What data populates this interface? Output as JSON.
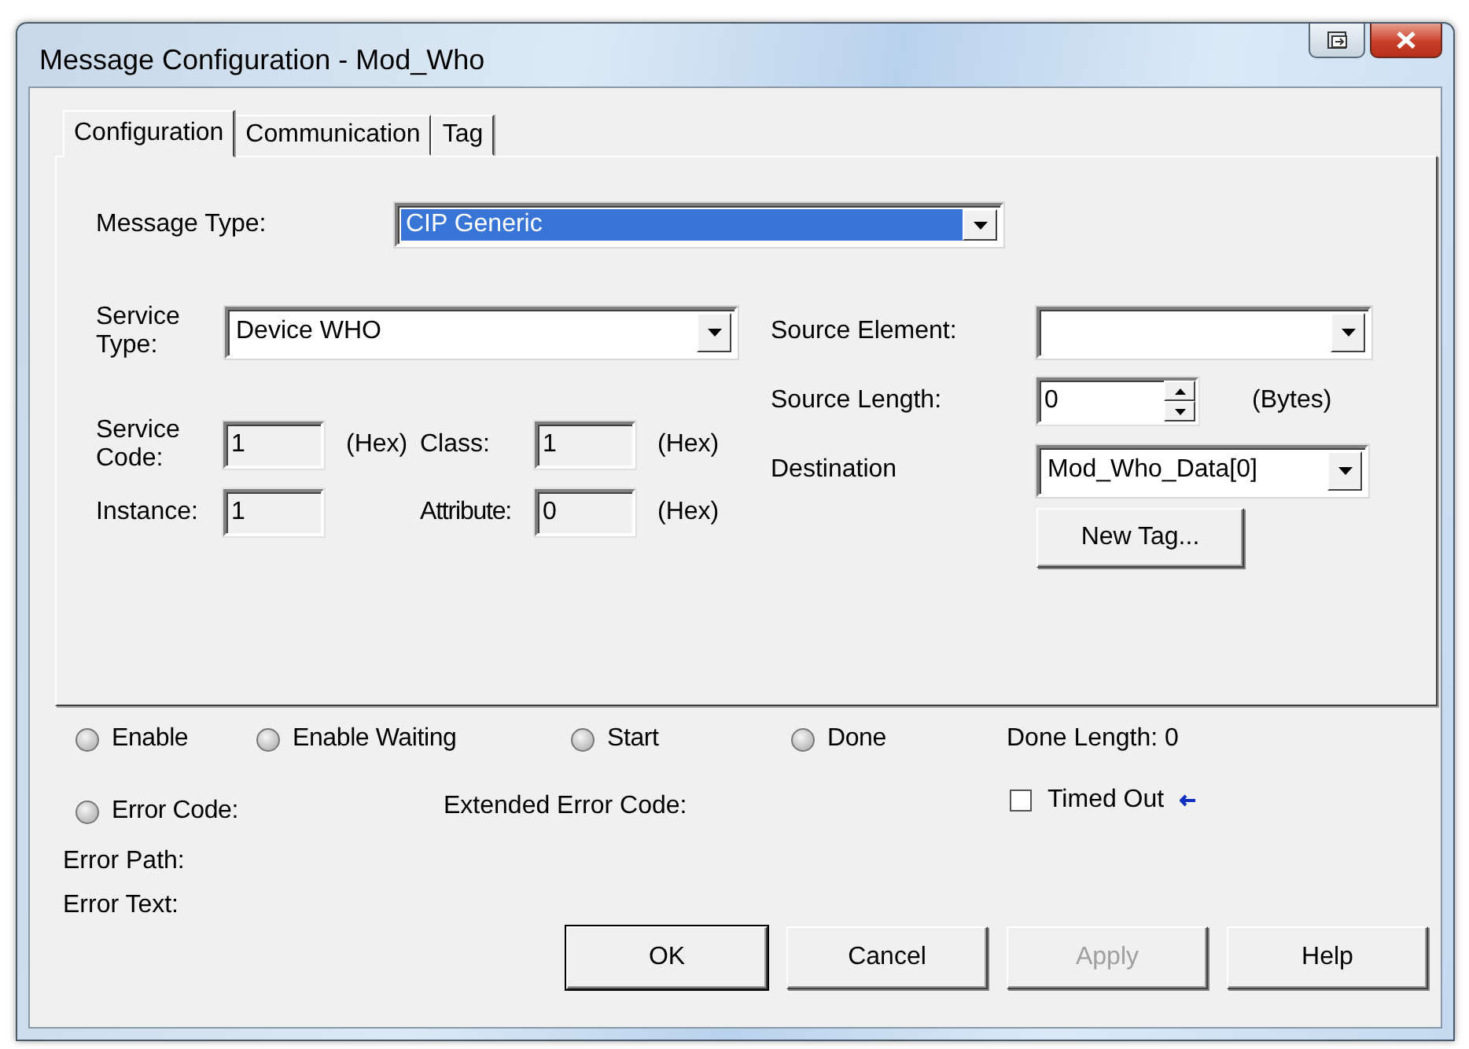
{
  "window": {
    "title": "Message Configuration - Mod_Who"
  },
  "tabs": [
    {
      "label": "Configuration",
      "selected": true
    },
    {
      "label": "Communication",
      "selected": false
    },
    {
      "label": "Tag",
      "selected": false
    }
  ],
  "message_type": {
    "label": "Message Type:",
    "value": "CIP Generic"
  },
  "service_type": {
    "label": "Service Type:",
    "value": "Device WHO"
  },
  "service_code": {
    "label": "Service Code:",
    "value": "1",
    "unit": "(Hex)"
  },
  "class": {
    "label": "Class:",
    "value": "1",
    "unit": "(Hex)"
  },
  "instance": {
    "label": "Instance:",
    "value": "1"
  },
  "attribute": {
    "label": "Attribute:",
    "value": "0",
    "unit": "(Hex)"
  },
  "source_element": {
    "label": "Source Element:"
  },
  "source_length": {
    "label": "Source Length:",
    "value": "0",
    "unit": "(Bytes)"
  },
  "destination": {
    "label": "Destination",
    "value": "Mod_Who_Data[0]"
  },
  "new_tag_button": {
    "label": "New Tag..."
  },
  "indicators": [
    {
      "label": "Enable",
      "on": false
    },
    {
      "label": "Enable Waiting",
      "on": false
    },
    {
      "label": "Start",
      "on": false
    },
    {
      "label": "Done",
      "on": false
    }
  ],
  "done_length": {
    "label": "Done Length:",
    "value": "0"
  },
  "error_code": {
    "label": "Error Code:",
    "on": false
  },
  "extended_error_code": {
    "label": "Extended Error Code:"
  },
  "timed_out": {
    "label": "Timed Out",
    "checked": false
  },
  "error_path": {
    "label": "Error Path:"
  },
  "error_text": {
    "label": "Error Text:"
  },
  "buttons": [
    {
      "label": "OK",
      "disabled": false
    },
    {
      "label": "Cancel",
      "disabled": false
    },
    {
      "label": "Apply",
      "disabled": true
    },
    {
      "label": "Help",
      "disabled": false
    }
  ]
}
